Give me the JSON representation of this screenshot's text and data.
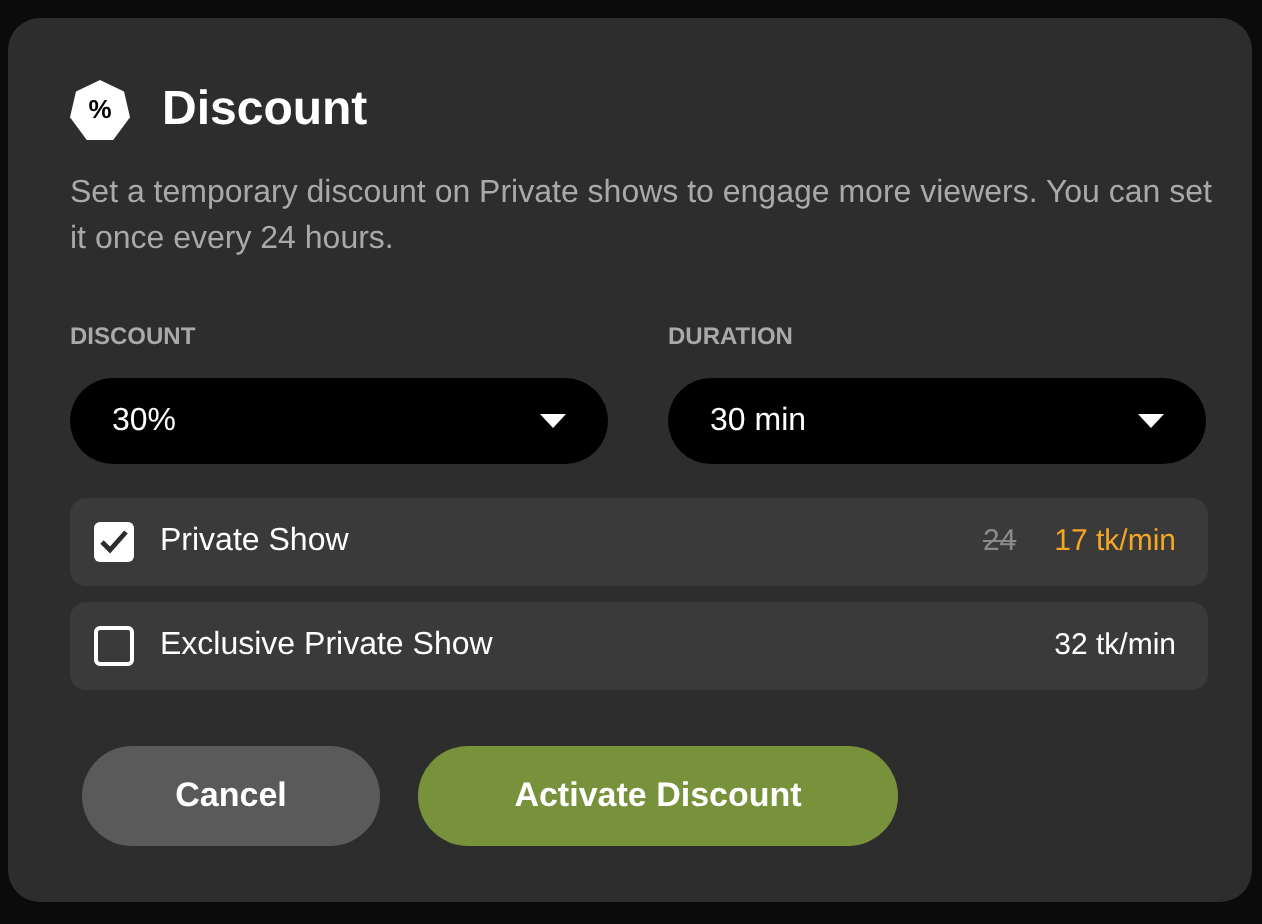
{
  "dialog": {
    "icon_text": "%",
    "title": "Discount",
    "description": "Set a temporary discount on Private shows to engage more viewers. You can set it once every 24 hours.",
    "selects": [
      {
        "label": "DISCOUNT",
        "value": "30%"
      },
      {
        "label": "DURATION",
        "value": "30 min"
      }
    ],
    "options": [
      {
        "label": "Private Show",
        "checked": true,
        "old_price": "24",
        "price": "17 tk/min"
      },
      {
        "label": "Exclusive Private Show",
        "checked": false,
        "price": "32 tk/min"
      }
    ],
    "buttons": [
      {
        "label": "Cancel",
        "kind": "secondary"
      },
      {
        "label": "Activate Discount",
        "kind": "primary"
      }
    ]
  }
}
